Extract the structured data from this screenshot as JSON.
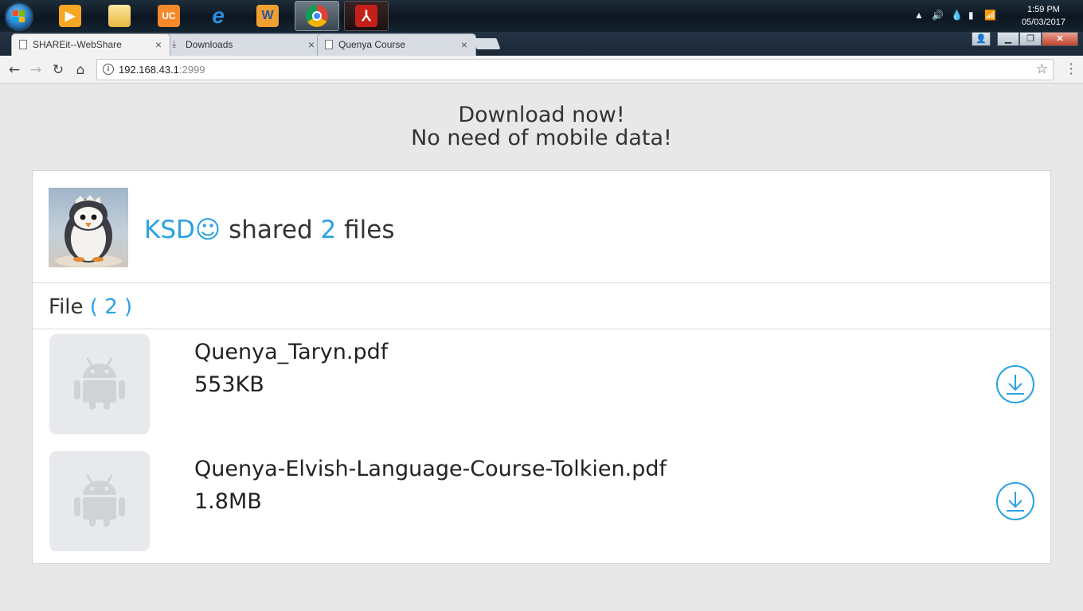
{
  "taskbar": {
    "apps": [
      {
        "name": "media-player",
        "label": "▶",
        "color": "#f5a623"
      },
      {
        "name": "file-explorer",
        "label": "",
        "color": "#f3d36b"
      },
      {
        "name": "uc-browser",
        "label": "UC",
        "color": "#f5882b"
      },
      {
        "name": "internet-explorer",
        "label": "e",
        "color": "#1e78d2"
      },
      {
        "name": "word",
        "label": "W",
        "color": "#f0a030"
      },
      {
        "name": "chrome",
        "label": "",
        "color": "#4caf50"
      },
      {
        "name": "acrobat",
        "label": "",
        "color": "#d8261c"
      }
    ],
    "clock": {
      "time": "1:59 PM",
      "date": "05/03/2017"
    }
  },
  "tabs": [
    {
      "title": "SHAREit--WebShare",
      "active": true
    },
    {
      "title": "Downloads",
      "active": false
    },
    {
      "title": "Quenya Course",
      "active": false
    }
  ],
  "toolbar": {
    "url_host": "192.168.43.1",
    "url_port": ":2999"
  },
  "headline": {
    "line1": "Download now!",
    "line2": "No need of mobile data!"
  },
  "share": {
    "user": "KSD☺",
    "verb": "shared",
    "count": "2",
    "noun": "files"
  },
  "files_section": {
    "label": "File",
    "count": "( 2 )"
  },
  "files": [
    {
      "name": "Quenya_Taryn.pdf",
      "size": "553KB"
    },
    {
      "name": "Quenya-Elvish-Language-Course-Tolkien.pdf",
      "size": "1.8MB"
    }
  ],
  "colors": {
    "accent": "#2aa1e3",
    "page_bg": "#e8e8e8"
  }
}
